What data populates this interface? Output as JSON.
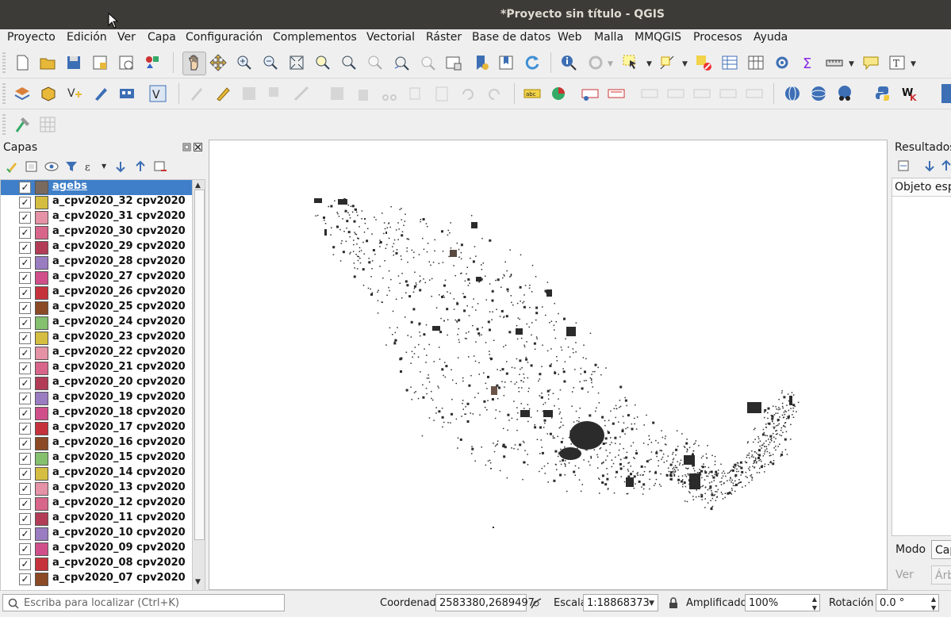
{
  "window": {
    "title": "*Proyecto sin título - QGIS"
  },
  "menu": [
    "Proyecto",
    "Edición",
    "Ver",
    "Capa",
    "Configuración",
    "Complementos",
    "Vectorial",
    "Ráster",
    "Base de datos",
    "Web",
    "Malla",
    "MMQGIS",
    "Procesos",
    "Ayuda"
  ],
  "layers_panel": {
    "title": "Capas",
    "layers": [
      {
        "name": "agebs",
        "color": "#7a6a5e",
        "checked": "✓"
      },
      {
        "name": "a_cpv2020_32 cpv2020",
        "color": "#d4bd40",
        "checked": "✓"
      },
      {
        "name": "a_cpv2020_31 cpv2020",
        "color": "#e591a6",
        "checked": "✓"
      },
      {
        "name": "a_cpv2020_30 cpv2020",
        "color": "#d8658a",
        "checked": "✓"
      },
      {
        "name": "a_cpv2020_29 cpv2020",
        "color": "#b23c56",
        "checked": "✓"
      },
      {
        "name": "a_cpv2020_28 cpv2020",
        "color": "#9a7cc1",
        "checked": "✓"
      },
      {
        "name": "a_cpv2020_27 cpv2020",
        "color": "#d04f8a",
        "checked": "✓"
      },
      {
        "name": "a_cpv2020_26 cpv2020",
        "color": "#c6323c",
        "checked": "✓"
      },
      {
        "name": "a_cpv2020_25 cpv2020",
        "color": "#8b4a25",
        "checked": "✓"
      },
      {
        "name": "a_cpv2020_24 cpv2020",
        "color": "#84c06d",
        "checked": "✓"
      },
      {
        "name": "a_cpv2020_23 cpv2020",
        "color": "#d4bd40",
        "checked": "✓"
      },
      {
        "name": "a_cpv2020_22 cpv2020",
        "color": "#e591a6",
        "checked": "✓"
      },
      {
        "name": "a_cpv2020_21 cpv2020",
        "color": "#d8658a",
        "checked": "✓"
      },
      {
        "name": "a_cpv2020_20 cpv2020",
        "color": "#b23c56",
        "checked": "✓"
      },
      {
        "name": "a_cpv2020_19 cpv2020",
        "color": "#9a7cc1",
        "checked": "✓"
      },
      {
        "name": "a_cpv2020_18 cpv2020",
        "color": "#d04f8a",
        "checked": "✓"
      },
      {
        "name": "a_cpv2020_17 cpv2020",
        "color": "#c6323c",
        "checked": "✓"
      },
      {
        "name": "a_cpv2020_16 cpv2020",
        "color": "#8b4a25",
        "checked": "✓"
      },
      {
        "name": "a_cpv2020_15 cpv2020",
        "color": "#84c06d",
        "checked": "✓"
      },
      {
        "name": "a_cpv2020_14 cpv2020",
        "color": "#d4bd40",
        "checked": "✓"
      },
      {
        "name": "a_cpv2020_13 cpv2020",
        "color": "#e591a6",
        "checked": "✓"
      },
      {
        "name": "a_cpv2020_12 cpv2020",
        "color": "#d8658a",
        "checked": "✓"
      },
      {
        "name": "a_cpv2020_11 cpv2020",
        "color": "#b23c56",
        "checked": "✓"
      },
      {
        "name": "a_cpv2020_10 cpv2020",
        "color": "#9a7cc1",
        "checked": "✓"
      },
      {
        "name": "a_cpv2020_09 cpv2020",
        "color": "#d04f8a",
        "checked": "✓"
      },
      {
        "name": "a_cpv2020_08 cpv2020",
        "color": "#c6323c",
        "checked": "✓"
      },
      {
        "name": "a_cpv2020_07 cpv2020",
        "color": "#8b4a25",
        "checked": "✓"
      }
    ]
  },
  "results_panel": {
    "title": "Resultados",
    "column": "Objeto esp",
    "mode_label": "Modo",
    "mode_value": "Cap",
    "view_label": "Ver",
    "view_value": "Árbol"
  },
  "statusbar": {
    "locator_placeholder": "Escriba para localizar (Ctrl+K)",
    "coord_label": "Coordenada",
    "coord_value": "2583380,2689497",
    "scale_label": "Escala",
    "scale_value": "1:18868373",
    "magnifier_label": "Amplificador",
    "magnifier_value": "100%",
    "rotation_label": "Rotación",
    "rotation_value": "0.0 °"
  },
  "toolbar_labels": {
    "label_tool": "abc"
  },
  "colors": {
    "titlebar": "#3c3b37",
    "selection": "#3f7fc9",
    "map_features": "#2b2b2b"
  }
}
